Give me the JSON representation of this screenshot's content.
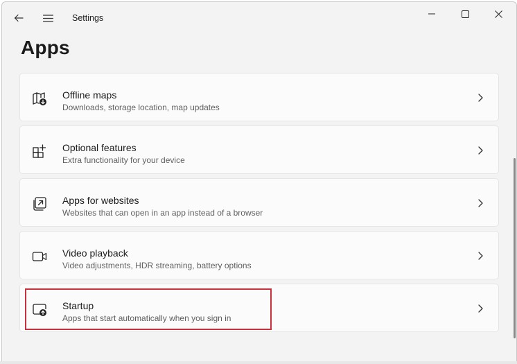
{
  "window": {
    "app_title": "Settings"
  },
  "page": {
    "title": "Apps"
  },
  "items": [
    {
      "title": "Offline maps",
      "desc": "Downloads, storage location, map updates",
      "icon": "map-download-icon"
    },
    {
      "title": "Optional features",
      "desc": "Extra functionality for your device",
      "icon": "add-feature-icon"
    },
    {
      "title": "Apps for websites",
      "desc": "Websites that can open in an app instead of a browser",
      "icon": "open-in-app-icon"
    },
    {
      "title": "Video playback",
      "desc": "Video adjustments, HDR streaming, battery options",
      "icon": "video-camera-icon"
    },
    {
      "title": "Startup",
      "desc": "Apps that start automatically when you sign in",
      "icon": "startup-icon"
    }
  ],
  "colors": {
    "highlight": "#c8303b",
    "window_bg": "#f3f3f3",
    "card_bg": "#fbfbfb"
  }
}
